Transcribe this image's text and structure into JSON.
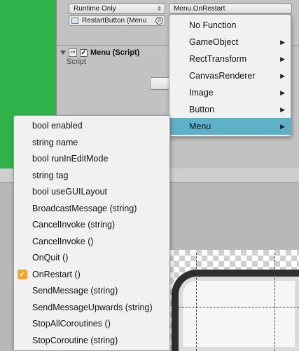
{
  "inspector": {
    "runtime_dropdown": "Runtime Only",
    "function_dropdown": "Menu.OnRestart",
    "object_field": "RestartButton (Menu",
    "component_title": "Menu (Script)",
    "script_label": "Script",
    "script_icon_text": "c#"
  },
  "menu1": {
    "items": [
      {
        "label": "No Function"
      },
      {
        "label": "GameObject",
        "has_sub": "▶"
      },
      {
        "label": "RectTransform",
        "has_sub": "▶"
      },
      {
        "label": "CanvasRenderer",
        "has_sub": "▶"
      },
      {
        "label": "Image",
        "has_sub": "▶"
      },
      {
        "label": "Button",
        "has_sub": "▶"
      },
      {
        "label": "Menu",
        "has_sub": "▶"
      }
    ]
  },
  "menu2": {
    "items": [
      {
        "label": "bool enabled"
      },
      {
        "label": "string name"
      },
      {
        "label": "bool runInEditMode"
      },
      {
        "label": "string tag"
      },
      {
        "label": "bool useGUILayout"
      },
      {
        "label": "BroadcastMessage (string)"
      },
      {
        "label": "CancelInvoke (string)"
      },
      {
        "label": "CancelInvoke ()"
      },
      {
        "label": "OnQuit ()"
      },
      {
        "label": "OnRestart ()"
      },
      {
        "label": "SendMessage (string)"
      },
      {
        "label": "SendMessageUpwards (string)"
      },
      {
        "label": "StopAllCoroutines ()"
      },
      {
        "label": "StopCoroutine (string)"
      }
    ]
  },
  "colors": {
    "highlight": "#5fb0c9",
    "check": "#f2a32b",
    "scene_green": "#2fb34a"
  },
  "icons": {
    "checkmark": "check-icon",
    "submenu": "chevron-right-icon"
  }
}
